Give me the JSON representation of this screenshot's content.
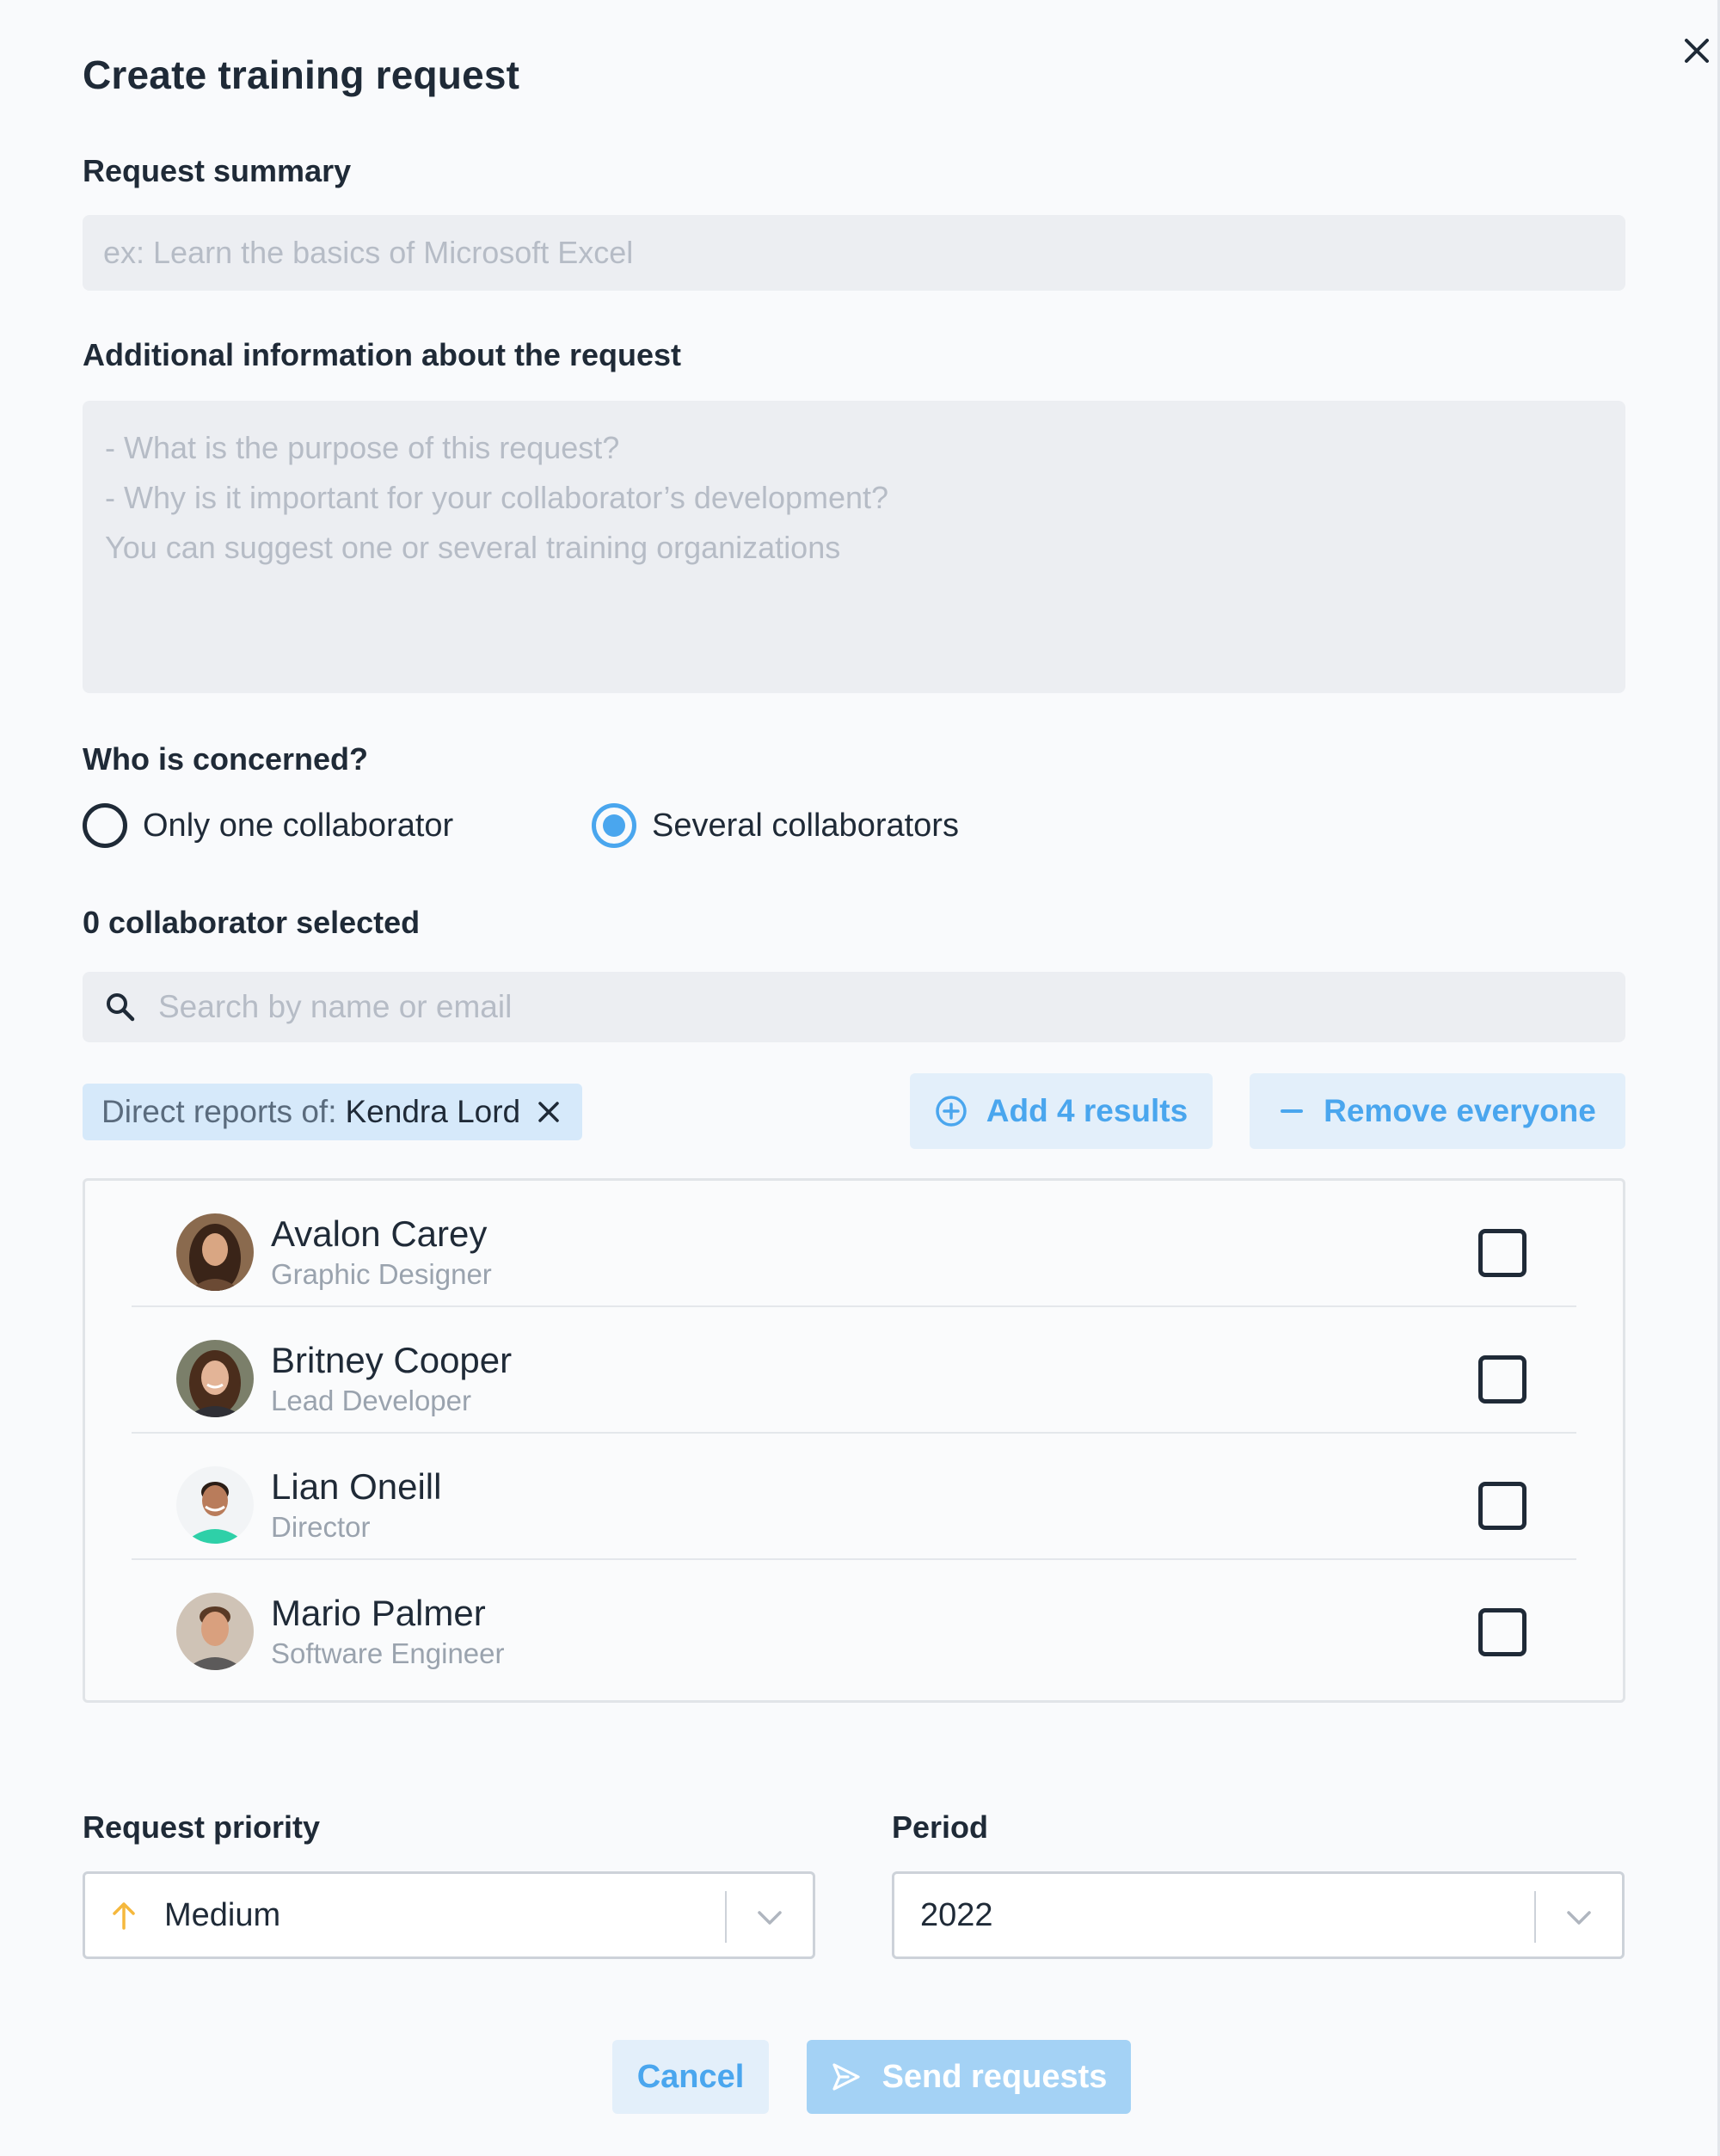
{
  "modal": {
    "title": "Create training request",
    "close_icon": "close-icon"
  },
  "request_summary": {
    "label": "Request summary",
    "placeholder": "ex: Learn the basics of Microsoft Excel",
    "value": ""
  },
  "additional_info": {
    "label": "Additional information about the request",
    "placeholder_lines": [
      "- What is the purpose of this request?",
      "- Why is it important for your collaborator’s development?",
      "You can suggest one or several training organizations"
    ]
  },
  "concerned": {
    "label": "Who is concerned?",
    "options": [
      {
        "label": "Only one collaborator",
        "selected": false
      },
      {
        "label": "Several collaborators",
        "selected": true
      }
    ]
  },
  "selection": {
    "count_text": "0 collaborator selected",
    "search_placeholder": "Search by name or email",
    "search_icon": "search-icon"
  },
  "filter_chip": {
    "prefix": "Direct reports of:",
    "name": "Kendra Lord",
    "remove_icon": "close-icon"
  },
  "actions": {
    "add_label": "Add 4 results",
    "add_icon": "plus-circle-icon",
    "remove_label": "Remove everyone",
    "remove_icon": "minus-icon"
  },
  "collaborators": [
    {
      "name": "Avalon Carey",
      "role": "Graphic Designer",
      "checked": false
    },
    {
      "name": "Britney Cooper",
      "role": "Lead Developer",
      "checked": false
    },
    {
      "name": "Lian Oneill",
      "role": "Director",
      "checked": false
    },
    {
      "name": "Mario Palmer",
      "role": "Software Engineer",
      "checked": false
    }
  ],
  "priority": {
    "label": "Request priority",
    "value": "Medium",
    "icon": "arrow-up-icon",
    "icon_color": "#f5b83d"
  },
  "period": {
    "label": "Period",
    "value": "2022"
  },
  "footer": {
    "cancel_label": "Cancel",
    "send_label": "Send requests",
    "send_icon": "send-icon"
  },
  "colors": {
    "accent": "#4aa6ee",
    "accent_light": "#e3effa",
    "chip_bg": "#d6e9fa",
    "disabled_primary": "#a4d2f5"
  }
}
